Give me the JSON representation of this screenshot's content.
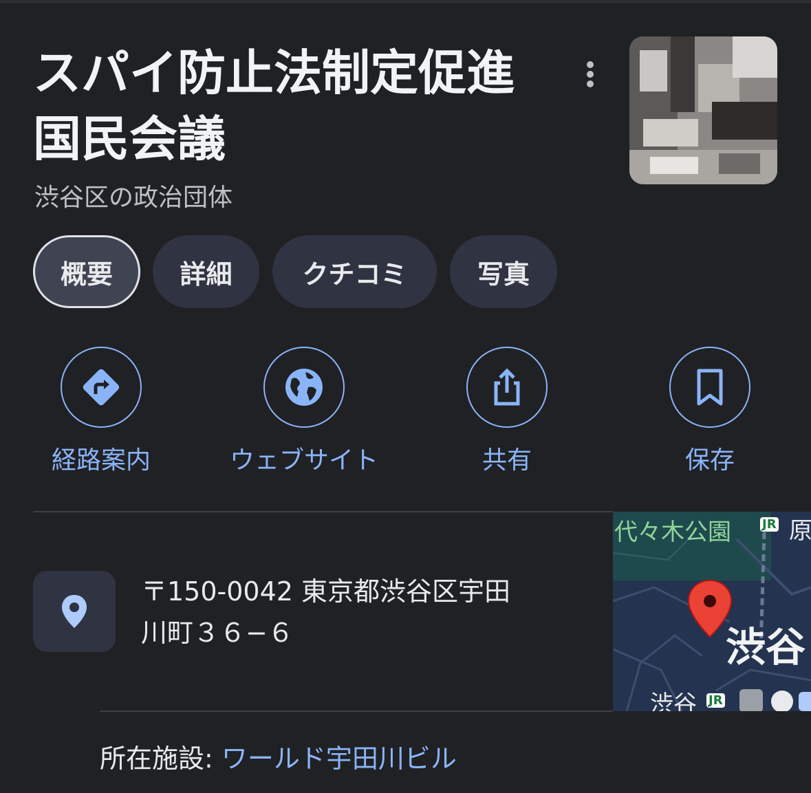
{
  "place": {
    "title_line1": "スパイ防止法制定促進",
    "title_line2": "国民会議",
    "subtitle": "渋谷区の政治団体"
  },
  "tabs": [
    {
      "label": "概要",
      "active": true
    },
    {
      "label": "詳細",
      "active": false
    },
    {
      "label": "クチコミ",
      "active": false
    },
    {
      "label": "写真",
      "active": false
    }
  ],
  "actions": [
    {
      "label": "経路案内",
      "icon": "directions-icon"
    },
    {
      "label": "ウェブサイト",
      "icon": "globe-icon"
    },
    {
      "label": "共有",
      "icon": "share-icon"
    },
    {
      "label": "保存",
      "icon": "bookmark-icon"
    }
  ],
  "address": {
    "line1": "〒150-0042 東京都渋谷区宇田",
    "line2": "川町３６−６"
  },
  "map": {
    "label_park": "代々木公園",
    "label_area": "渋谷",
    "label_station": "渋谷",
    "label_partial": "原",
    "jr_badge": "JR"
  },
  "facility": {
    "label": "所在施設: ",
    "value": "ワールド宇田川ビル"
  },
  "colors": {
    "background": "#202124",
    "accent": "#8ab4f8",
    "chip": "#303341",
    "pin": "#ea4335"
  }
}
